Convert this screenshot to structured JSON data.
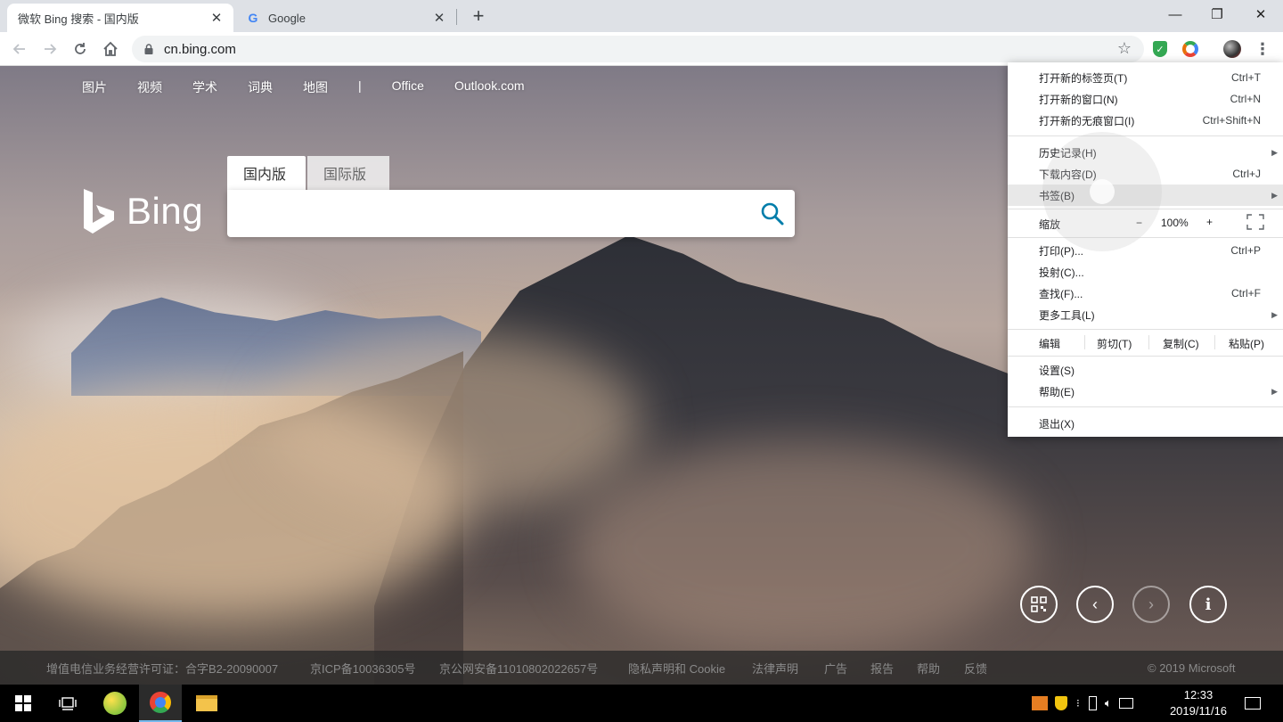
{
  "browser": {
    "tabs": [
      {
        "title": "微软 Bing 搜索 - 国内版",
        "favicon": "bing-icon",
        "active": true
      },
      {
        "title": "Google",
        "favicon": "google-icon",
        "active": false
      }
    ],
    "new_tab": "+",
    "window_controls": {
      "minimize": "—",
      "restore": "❐",
      "close": "✕"
    },
    "url": "cn.bing.com",
    "nav_icons": [
      "back-icon",
      "forward-icon",
      "reload-icon",
      "home-icon",
      "lock-icon",
      "star-icon"
    ],
    "extension_icons": [
      "shield-icon",
      "ring-extension-icon",
      "profile-avatar",
      "menu-kebab-icon"
    ]
  },
  "bing": {
    "nav": [
      "图片",
      "视频",
      "学术",
      "词典",
      "地图",
      "|",
      "Office",
      "Outlook.com"
    ],
    "logo_text": "Bing",
    "search_tabs": [
      "国内版",
      "国际版"
    ],
    "search_value": "",
    "footer": {
      "license": "增值电信业务经营许可证：合字B2-20090007",
      "icp": "京ICP备10036305号",
      "police": "京公网安备11010802022657号",
      "privacy": "隐私声明和 Cookie",
      "legal": "法律声明",
      "ads": "广告",
      "report": "报告",
      "help": "帮助",
      "feedback": "反馈",
      "copyright": "© 2019 Microsoft"
    }
  },
  "menu": {
    "new_tab": {
      "label": "打开新的标签页(T)",
      "shortcut": "Ctrl+T"
    },
    "new_window": {
      "label": "打开新的窗口(N)",
      "shortcut": "Ctrl+N"
    },
    "incognito": {
      "label": "打开新的无痕窗口(I)",
      "shortcut": "Ctrl+Shift+N"
    },
    "history": {
      "label": "历史记录(H)"
    },
    "downloads": {
      "label": "下载内容(D)",
      "shortcut": "Ctrl+J"
    },
    "bookmarks": {
      "label": "书签(B)"
    },
    "zoom": {
      "label": "缩放",
      "minus": "−",
      "value": "100%",
      "plus": "+"
    },
    "print": {
      "label": "打印(P)...",
      "shortcut": "Ctrl+P"
    },
    "cast": {
      "label": "投射(C)..."
    },
    "find": {
      "label": "查找(F)...",
      "shortcut": "Ctrl+F"
    },
    "more_tools": {
      "label": "更多工具(L)"
    },
    "edit": {
      "label": "编辑",
      "cut": "剪切(T)",
      "copy": "复制(C)",
      "paste": "粘贴(P)"
    },
    "settings": {
      "label": "设置(S)"
    },
    "help": {
      "label": "帮助(E)"
    },
    "exit": {
      "label": "退出(X)"
    }
  },
  "taskbar": {
    "time": "12:33",
    "date": "2019/11/16"
  }
}
